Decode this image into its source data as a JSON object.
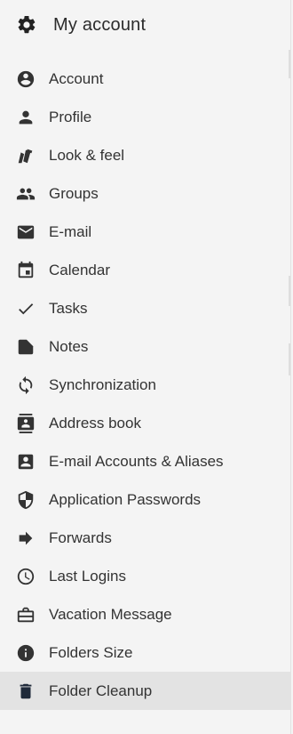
{
  "header": {
    "title": "My account",
    "icon": "gear-icon"
  },
  "menu": {
    "items": [
      {
        "label": "Account",
        "icon": "account-circle-icon"
      },
      {
        "label": "Profile",
        "icon": "person-icon"
      },
      {
        "label": "Look & feel",
        "icon": "swatches-icon"
      },
      {
        "label": "Groups",
        "icon": "group-icon"
      },
      {
        "label": "E-mail",
        "icon": "envelope-icon"
      },
      {
        "label": "Calendar",
        "icon": "calendar-icon"
      },
      {
        "label": "Tasks",
        "icon": "check-icon"
      },
      {
        "label": "Notes",
        "icon": "note-icon"
      },
      {
        "label": "Synchronization",
        "icon": "sync-icon"
      },
      {
        "label": "Address book",
        "icon": "contacts-book-icon"
      },
      {
        "label": "E-mail Accounts & Aliases",
        "icon": "contact-card-icon"
      },
      {
        "label": "Application Passwords",
        "icon": "shield-icon"
      },
      {
        "label": "Forwards",
        "icon": "arrow-right-icon"
      },
      {
        "label": "Last Logins",
        "icon": "clock-icon"
      },
      {
        "label": "Vacation Message",
        "icon": "suitcase-icon"
      },
      {
        "label": "Folders Size",
        "icon": "info-icon"
      },
      {
        "label": "Folder Cleanup",
        "icon": "trash-icon"
      }
    ],
    "active_index": 16
  },
  "colors": {
    "icon": "#333333",
    "active_bg": "#e3e3e3",
    "panel_bg": "#f4f4f4"
  }
}
